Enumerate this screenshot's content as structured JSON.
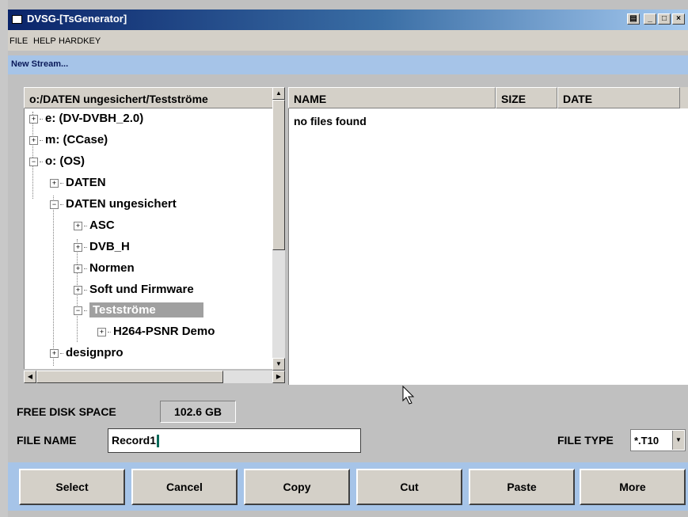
{
  "window": {
    "title": "DVSG-[TsGenerator]",
    "controls": [
      "restore",
      "minimize",
      "maximize",
      "close"
    ]
  },
  "menu": {
    "items": [
      "FILE",
      "HELP",
      "HARDKEY"
    ]
  },
  "section_title": "New Stream...",
  "tree": {
    "header": "o:/DATEN ungesichert/Testströme",
    "items": [
      {
        "label": "e: (DV-DVBH_2.0)",
        "expander": "+"
      },
      {
        "label": "m: (CCase)",
        "expander": "+"
      },
      {
        "label": "o: (OS)",
        "expander": "-"
      },
      {
        "label": "DATEN",
        "expander": "+"
      },
      {
        "label": "DATEN ungesichert",
        "expander": "-"
      },
      {
        "label": "ASC",
        "expander": "+"
      },
      {
        "label": "DVB_H",
        "expander": "+"
      },
      {
        "label": "Normen",
        "expander": "+"
      },
      {
        "label": "Soft und Firmware",
        "expander": "+"
      },
      {
        "label": "Testströme",
        "expander": "-",
        "selected": true
      },
      {
        "label": "H264-PSNR Demo",
        "expander": "+"
      },
      {
        "label": "designpro",
        "expander": "+"
      }
    ]
  },
  "files": {
    "columns": [
      "NAME",
      "SIZE",
      "DATE"
    ],
    "empty_message": "no files found"
  },
  "free_disk_space": {
    "label": "FREE DISK SPACE",
    "value": "102.6 GB"
  },
  "file_name": {
    "label": "FILE NAME",
    "value": "Record1"
  },
  "file_type": {
    "label": "FILE TYPE",
    "value": "*.T10"
  },
  "buttons": [
    "Select",
    "Cancel",
    "Copy",
    "Cut",
    "Paste",
    "More"
  ],
  "colors": {
    "title_gradient_start": "#0a246a",
    "section_bar": "#a6c4e8",
    "selected_item": "#a0a0a0"
  }
}
